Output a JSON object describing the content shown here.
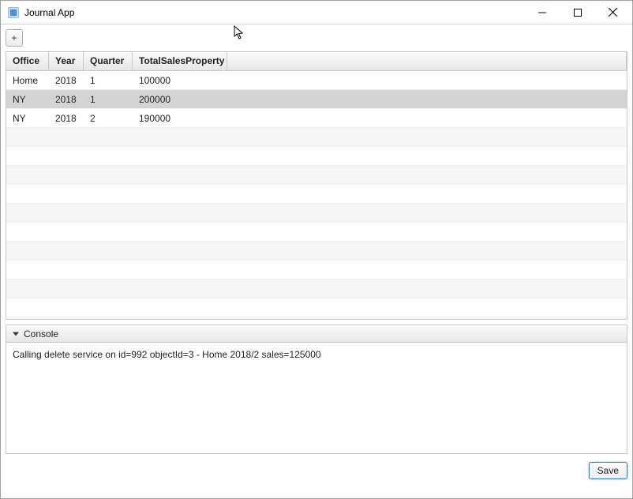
{
  "window": {
    "title": "Journal App"
  },
  "toolbar": {
    "add_label": "+"
  },
  "grid": {
    "columns": {
      "office": "Office",
      "year": "Year",
      "quarter": "Quarter",
      "total": "TotalSalesProperty"
    },
    "rows": [
      {
        "office": "Home",
        "year": "2018",
        "quarter": "1",
        "total": "100000",
        "selected": false
      },
      {
        "office": "NY",
        "year": "2018",
        "quarter": "1",
        "total": "200000",
        "selected": true
      },
      {
        "office": "NY",
        "year": "2018",
        "quarter": "2",
        "total": "190000",
        "selected": false
      }
    ],
    "empty_row_count": 11
  },
  "console": {
    "title": "Console",
    "text": "Calling delete service on id=992 objectId=3 - Home 2018/2 sales=125000"
  },
  "footer": {
    "save_label": "Save"
  }
}
